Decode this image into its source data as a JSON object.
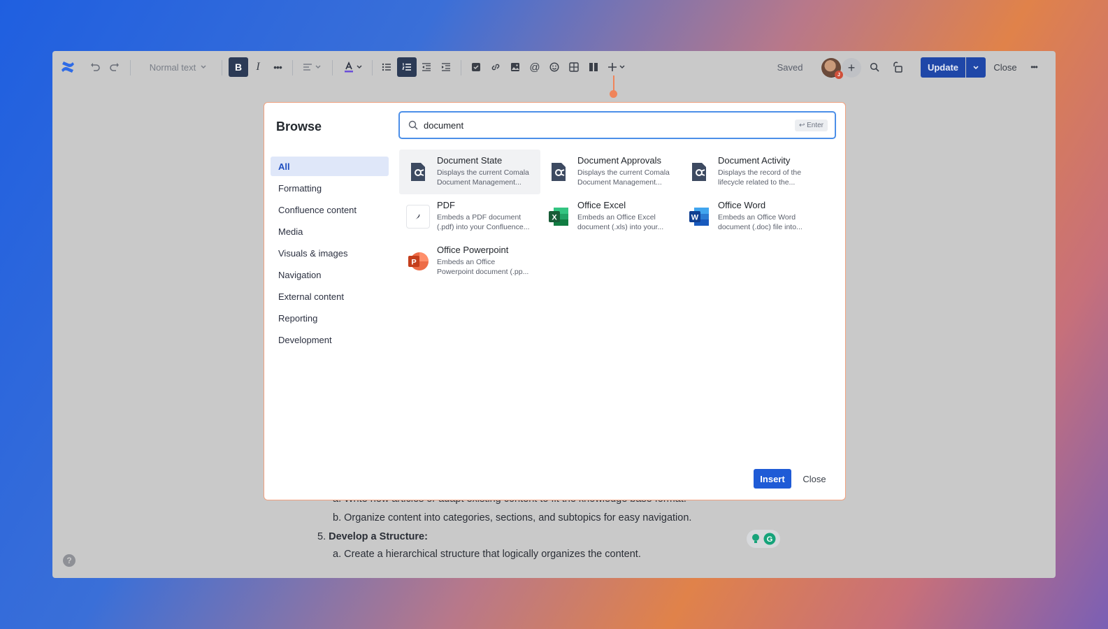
{
  "toolbar": {
    "text_style": "Normal text",
    "saved_status": "Saved",
    "update_label": "Update",
    "close_label": "Close",
    "avatar_badge": "J"
  },
  "document": {
    "line_a1": "a. Write new articles or adapt existing content to fit the knowledge base format.",
    "line_b1": "b. Organize content into categories, sections, and subtopics for easy navigation.",
    "item5_num": "5.",
    "item5_title": "Develop a Structure:",
    "line_a2": "a. Create a hierarchical structure that logically organizes the content.",
    "help": "?"
  },
  "modal": {
    "title": "Browse",
    "search_value": "document",
    "enter_hint": "↩ Enter",
    "categories": [
      "All",
      "Formatting",
      "Confluence content",
      "Media",
      "Visuals & images",
      "Navigation",
      "External content",
      "Reporting",
      "Development"
    ],
    "results": [
      {
        "title": "Document State",
        "desc1": "Displays the current Comala",
        "desc2": "Document Management...",
        "icon": "comala-icon"
      },
      {
        "title": "Document Approvals",
        "desc1": "Displays the current Comala",
        "desc2": "Document Management...",
        "icon": "comala-icon"
      },
      {
        "title": "Document Activity",
        "desc1": "Displays the record of the",
        "desc2": "lifecycle related to the...",
        "icon": "comala-icon"
      },
      {
        "title": "PDF",
        "desc1": "Embeds a PDF document",
        "desc2": "(.pdf) into your Confluence...",
        "icon": "pdf-icon"
      },
      {
        "title": "Office Excel",
        "desc1": "Embeds an Office Excel",
        "desc2": "document (.xls) into your...",
        "icon": "excel-icon"
      },
      {
        "title": "Office Word",
        "desc1": "Embeds an Office Word",
        "desc2": "document (.doc) file into...",
        "icon": "word-icon"
      },
      {
        "title": "Office Powerpoint",
        "desc1": "Embeds an Office",
        "desc2": "Powerpoint document (.pp...",
        "icon": "powerpoint-icon"
      }
    ],
    "insert_label": "Insert",
    "close_label": "Close"
  },
  "colors": {
    "primary": "#1f5bd6",
    "accent_connector": "#f0845a",
    "update_button": "#1f47a8"
  }
}
